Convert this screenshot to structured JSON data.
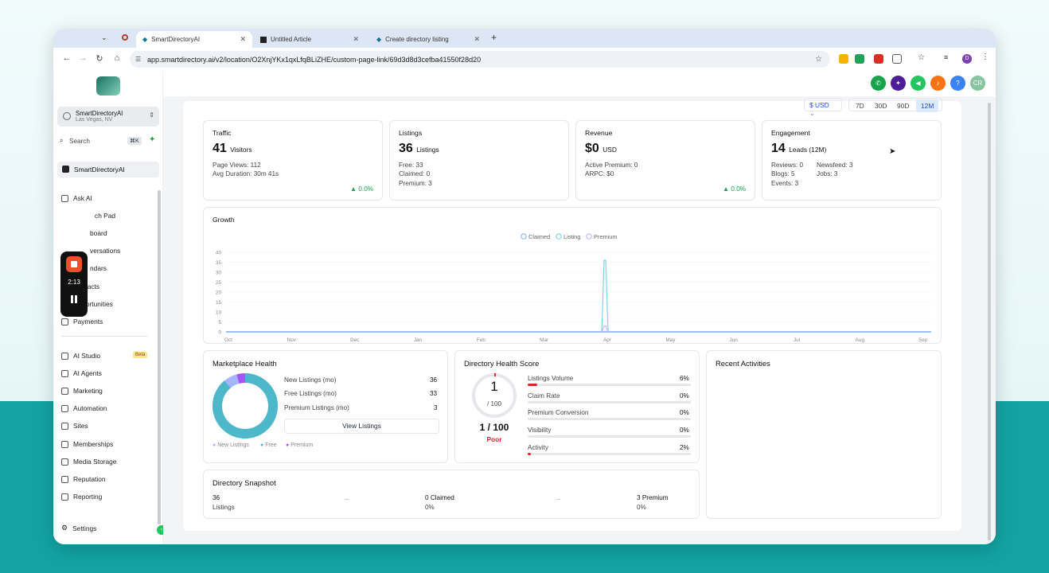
{
  "browser": {
    "tabs": [
      "SmartDirectoryAI",
      "Untitled Article",
      "Create directory listing"
    ],
    "url": "app.smartdirectory.ai/v2/location/O2XnjYKx1qxLfqBLiZHE/custom-page-link/69d3d8d3cefba41550f28d20",
    "profile_initial": "D"
  },
  "sidebar": {
    "account_name": "SmartDirectoryAI",
    "account_location": "Las Vegas, NV",
    "search_placeholder": "Search",
    "search_shortcut": "⌘K",
    "company": "SmartDirectoryAI",
    "items_top": [
      "Ask AI",
      "ch Pad",
      "board",
      "versations",
      "ndars",
      "Contacts",
      "Opportunities",
      "Payments"
    ],
    "items_bottom": [
      "AI Studio",
      "AI Agents",
      "Marketing",
      "Automation",
      "Sites",
      "Memberships",
      "Media Storage",
      "Reputation",
      "Reporting"
    ],
    "ai_studio_badge": "Beta",
    "settings": "Settings",
    "recorder_time": "2:13"
  },
  "header": {
    "avatar": "CR"
  },
  "controls": {
    "currency": "$ USD",
    "ranges": [
      "7D",
      "30D",
      "90D",
      "12M"
    ],
    "active_range": "12M"
  },
  "cards": {
    "traffic": {
      "title": "Traffic",
      "value": "41",
      "unit": "Visitors",
      "l1": "Page Views: 112",
      "l2": "Avg Duration: 30m 41s",
      "delta": "▲ 0.0%"
    },
    "listings": {
      "title": "Listings",
      "value": "36",
      "unit": "Listings",
      "l1": "Free: 33",
      "l2": "Claimed: 0",
      "l3": "Premium: 3"
    },
    "revenue": {
      "title": "Revenue",
      "value": "$0",
      "unit": "USD",
      "l1": "Active Premium: 0",
      "l2": "ARPC: $0",
      "delta": "▲ 0.0%"
    },
    "engagement": {
      "title": "Engagement",
      "value": "14",
      "unit": "Leads (12M)",
      "l1": "Reviews: 0",
      "l1b": "Newsfeed: 3",
      "l2": "Blogs: 5",
      "l2b": "Jobs: 3",
      "l3": "Events: 3"
    }
  },
  "growth": {
    "title": "Growth"
  },
  "chart_data": {
    "type": "line",
    "x": [
      "Oct",
      "Nov",
      "Dec",
      "Jan",
      "Feb",
      "Mar",
      "Apr",
      "May",
      "Jun",
      "Jul",
      "Aug",
      "Sep"
    ],
    "yticks": [
      "0",
      "5",
      "10",
      "15",
      "20",
      "25",
      "30",
      "35",
      "40"
    ],
    "ylim": [
      0,
      40
    ],
    "legend": [
      "Claimed",
      "Listing",
      "Premium"
    ],
    "series": [
      {
        "name": "Claimed",
        "color": "#93b4f5",
        "values": [
          0,
          0,
          0,
          0,
          0,
          0,
          0,
          0,
          0,
          0,
          0,
          0
        ]
      },
      {
        "name": "Listing",
        "color": "#7dd3e8",
        "spike": {
          "near": "Apr",
          "value": 36
        }
      },
      {
        "name": "Premium",
        "color": "#c4b5fd",
        "spike": {
          "near": "Apr",
          "value": 3
        }
      }
    ]
  },
  "marketplace": {
    "title": "Marketplace Health",
    "rows": [
      [
        "New Listings (mo)",
        "36"
      ],
      [
        "Free Listings (mo)",
        "33"
      ],
      [
        "Premium Listings (mo)",
        "3"
      ]
    ],
    "button": "View Listings",
    "legend": [
      "New Listings",
      "Free",
      "Premium"
    ]
  },
  "health": {
    "title": "Directory Health Score",
    "score": "1",
    "score_den": "/ 100",
    "score_text": "1 / 100",
    "rating": "Poor",
    "metrics": [
      [
        "Listings Volume",
        "6%",
        6
      ],
      [
        "Claim Rate",
        "0%",
        0
      ],
      [
        "Premium Conversion",
        "0%",
        0
      ],
      [
        "Visibility",
        "0%",
        0
      ],
      [
        "Activity",
        "2%",
        2
      ]
    ]
  },
  "recent": {
    "title": "Recent Activities"
  },
  "snapshot": {
    "title": "Directory Snapshot",
    "cols": [
      [
        "36",
        "Listings"
      ],
      [
        "0 Claimed",
        "0%"
      ],
      [
        "3 Premium",
        "0%"
      ]
    ]
  }
}
